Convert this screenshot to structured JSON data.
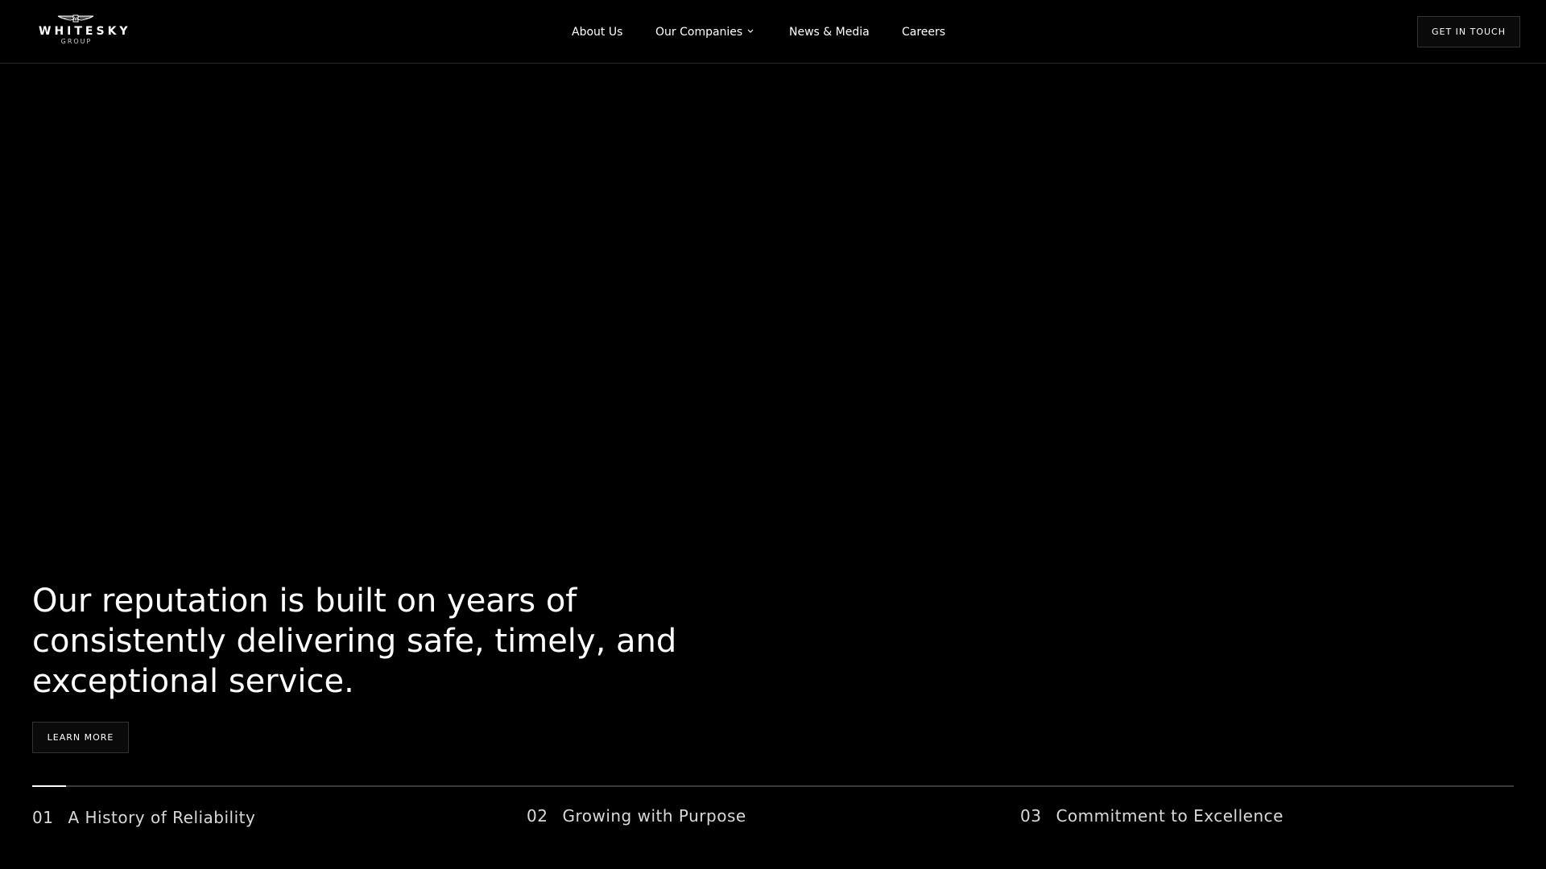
{
  "header": {
    "logo": {
      "name": "WHITESKY",
      "sub": "GROUP"
    },
    "nav": [
      {
        "label": "About Us"
      },
      {
        "label": "Our Companies"
      },
      {
        "label": "News & Media"
      },
      {
        "label": "Careers"
      }
    ],
    "cta_label": "GET IN TOUCH"
  },
  "hero": {
    "headline": "Our reputation is built on years of consistently delivering safe, timely, and exceptional service.",
    "button_label": "LEARN MORE"
  },
  "slides": {
    "progress_fraction": 0.023,
    "items": [
      {
        "number": "01",
        "label": "A History of Reliability"
      },
      {
        "number": "02",
        "label": "Growing with Purpose"
      },
      {
        "number": "03",
        "label": "Commitment to Excellence"
      }
    ]
  },
  "colors": {
    "background": "#000000",
    "text": "#ffffff",
    "muted_text": "#d9d9d9",
    "border": "#333333",
    "track": "#3a3a3a"
  },
  "icons": {
    "logo_mark": "wings-icon",
    "dropdown": "chevron-down-icon"
  }
}
